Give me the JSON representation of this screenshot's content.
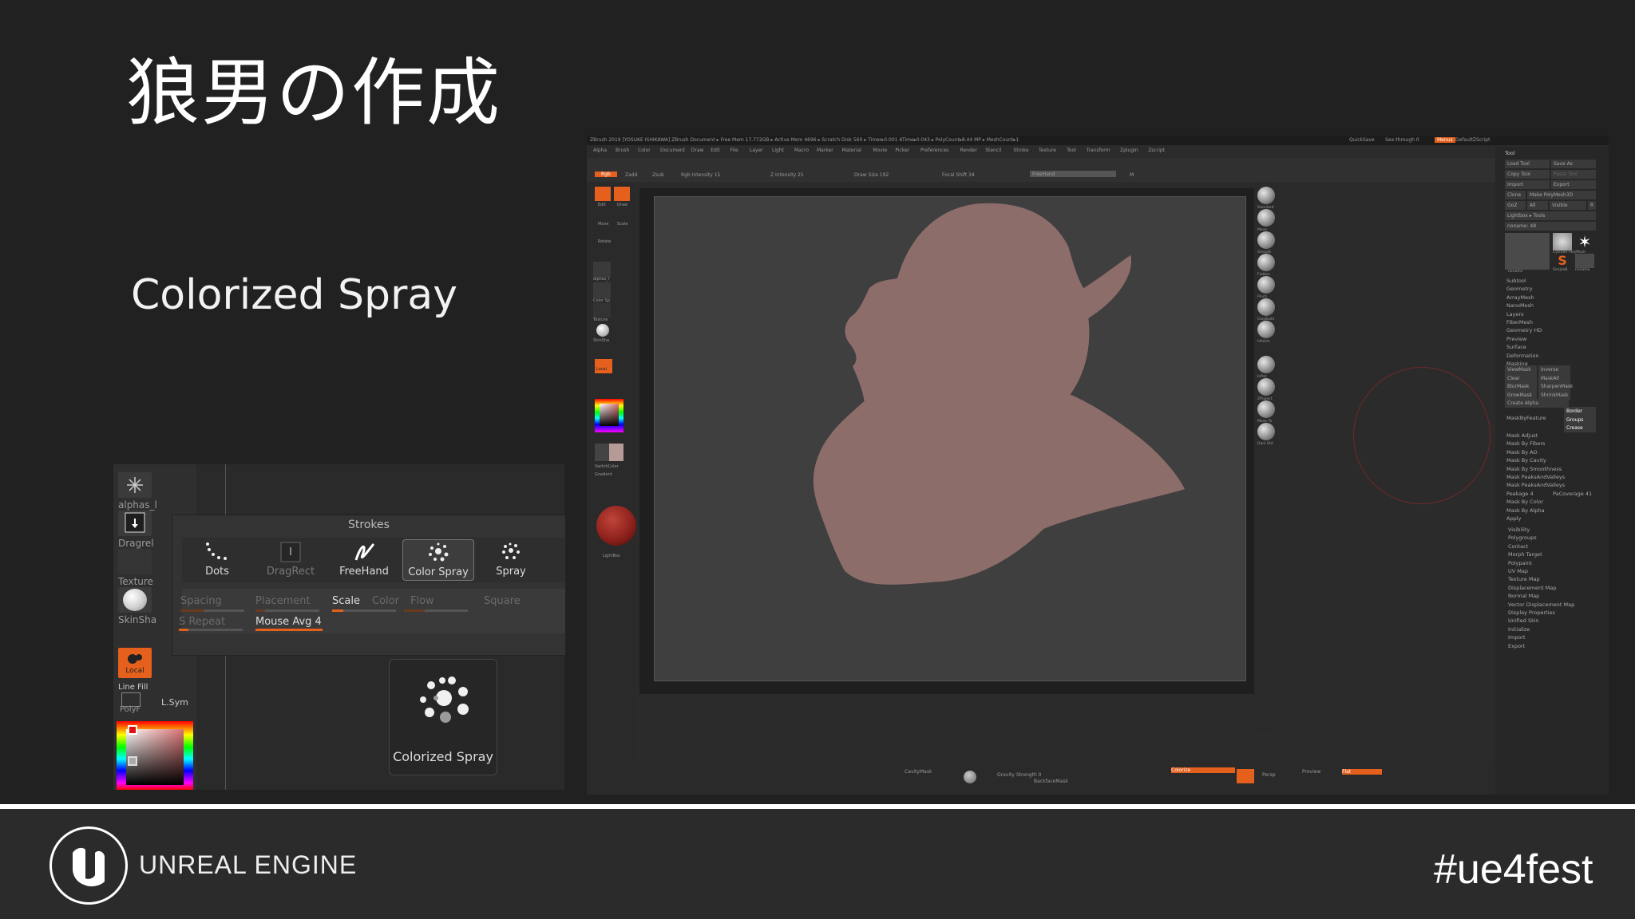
{
  "slide": {
    "title": "狼男の作成",
    "subtitle": "Colorized Spray",
    "hashtag": "#ue4fest",
    "logo_text": "UNREAL ENGINE"
  },
  "brush_panel": {
    "left_tiles": [
      "alphas_l",
      "Dragrel",
      "Texture",
      "SkinSha"
    ],
    "material_label": "Local",
    "line_fill": "Line Fill",
    "polyf": "PolyF",
    "lsym": "L.Sym",
    "strokes_title": "Strokes",
    "strokes": [
      {
        "label": "Dots",
        "selected": false,
        "dim": false
      },
      {
        "label": "DragRect",
        "selected": false,
        "dim": true
      },
      {
        "label": "FreeHand",
        "selected": false,
        "dim": false
      },
      {
        "label": "Color Spray",
        "selected": true,
        "dim": false
      },
      {
        "label": "Spray",
        "selected": false,
        "dim": false
      }
    ],
    "props": [
      {
        "label": "Spacing",
        "on": false
      },
      {
        "label": "Placement",
        "on": false
      },
      {
        "label": "Scale",
        "on": true
      },
      {
        "label": "Color",
        "on": false
      },
      {
        "label": "Flow",
        "on": false
      },
      {
        "label": "Square",
        "on": false
      }
    ],
    "repeat_label": "S Repeat",
    "mouse_avg": "Mouse Avg 4",
    "tooltip_label": "Colorized Spray"
  },
  "zbrush": {
    "title_bar": "ZBrush 2019 [YOSUKE ISHIKAWA]  ZBrush Document  ▸ Free Mem 17.772GB ▸ Active Mem 4696 ▸ Scratch Disk 560 ▸ Timer▸0.001 ATime▸0.043 ▸ PolyCount▸8.44 MP ▸ MeshCount▸1",
    "title_right": [
      "QuickSave",
      "See-through 0",
      "Menus",
      "DefaultZScript"
    ],
    "menu": [
      "Alpha",
      "Brush",
      "Color",
      "Document",
      "Draw",
      "Edit",
      "File",
      "Layer",
      "Light",
      "Macro",
      "Marker",
      "Material",
      "Movie",
      "Picker",
      "Preferences",
      "Render",
      "Stencil",
      "Stroke",
      "Texture",
      "Tool",
      "Transform",
      "Zplugin",
      "Zscript"
    ],
    "top_shelf": [
      "Rgb",
      "Zadd",
      "Zsub",
      "Rgb Intensity 15",
      "Z Intensity 25",
      "Draw Size 192",
      "Focal Shift 34",
      "FreeHand",
      "M"
    ],
    "left_labels": [
      "Edit",
      "Draw",
      "Move",
      "Scale",
      "Rotate",
      "alphas_l",
      "Color Sp",
      "Texture",
      "SkinSha",
      "Local",
      "SwitchColor",
      "Gradient",
      "LightBox"
    ],
    "right_shelf": [
      "Standard",
      "Move",
      "Smooth",
      "Flatten",
      "Pinch",
      "ClayBuild",
      "hPolish",
      "Inflat",
      "ZProject",
      "Move To",
      "Dam Std"
    ],
    "tool_panel_title": "Tool",
    "tool_buttons": [
      [
        "Load Tool",
        "Save As"
      ],
      [
        "Copy Tool",
        "Paste Tool"
      ],
      [
        "Import",
        "Export"
      ],
      [
        "Clone",
        "Make PolyMesh3D"
      ],
      [
        "GoZ",
        "All",
        "Visible",
        "R"
      ],
      [
        "Lightbox ▸ Tools"
      ],
      [
        "noname: 48"
      ]
    ],
    "tool_thumbs": [
      "noname",
      "Cylinder PolyMesh",
      "SimpleB",
      "noname"
    ],
    "tool_sections": [
      "Subtool",
      "Geometry",
      "ArrayMesh",
      "NanoMesh",
      "Layers",
      "FiberMesh",
      "Geometry HD",
      "Preview",
      "Surface",
      "Deformation",
      "Masking"
    ],
    "masking_buttons": [
      [
        "ViewMask",
        "Inverse"
      ],
      [
        "Clear",
        "MaskAll"
      ],
      [
        "BlurMask",
        "SharpenMask"
      ],
      [
        "GrowMask",
        "ShrinkMask"
      ],
      [
        "Create Alpha"
      ]
    ],
    "masking_orange": [
      "Border",
      "Groups",
      "Crease"
    ],
    "mask_feature": "MaskByFeature",
    "mask_items": [
      "Mask Adjust",
      "Mask By Fibers",
      "Mask By AO",
      "Mask By Cavity",
      "Mask By Smoothness",
      "Mask PeaksAndValleys",
      "Mask PeaksAndValleys",
      "Peakage 4",
      "PaCoverage 41",
      "Mask By Color",
      "Mask By Alpha",
      "Apply"
    ],
    "tool_sections2": [
      "Visibility",
      "Polygroups",
      "Contact",
      "Morph Target",
      "Polypaint",
      "UV Map",
      "Texture Map",
      "Displacement Map",
      "Normal Map",
      "Vector Displacement Map",
      "Display Properties",
      "Unified Skin",
      "Initialize",
      "Import",
      "Export"
    ],
    "bottom_bar": [
      "CavityMask",
      "Gravity Strength 0",
      "BackfaceMask",
      "Colorize",
      "Persp",
      "Preview",
      "Flat"
    ]
  },
  "colors": {
    "accent": "#e5601c",
    "silhouette": "#8d6d6a",
    "background": "#212121"
  }
}
